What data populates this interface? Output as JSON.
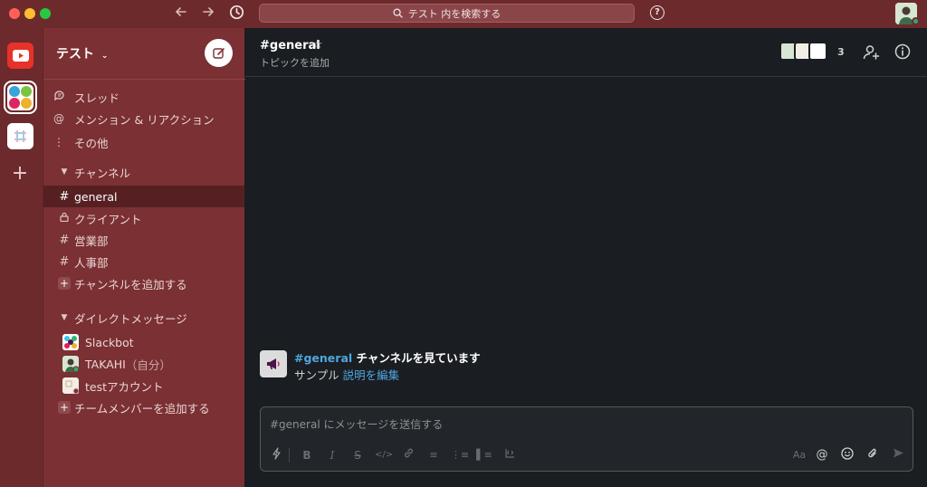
{
  "titlebar": {
    "search_placeholder": "テスト 内を検索する",
    "help_label": "?"
  },
  "rail": {
    "workspaces": [
      "youtube",
      "テスト",
      "slack"
    ]
  },
  "sidebar": {
    "workspace_name": "テスト",
    "top_items": [
      {
        "label": "スレッド",
        "icon": "threads-icon"
      },
      {
        "label": "メンション & リアクション",
        "icon": "at-icon"
      },
      {
        "label": "その他",
        "icon": "more-vertical-icon"
      }
    ],
    "channels_header": "チャンネル",
    "channels": [
      {
        "label": "general",
        "icon": "#",
        "active": true
      },
      {
        "label": "クライアント",
        "icon": "lock",
        "active": false
      },
      {
        "label": "営業部",
        "icon": "#",
        "active": false
      },
      {
        "label": "人事部",
        "icon": "#",
        "active": false
      }
    ],
    "add_channel": "チャンネルを追加する",
    "dm_header": "ダイレクトメッセージ",
    "dms": [
      {
        "label": "Slackbot"
      },
      {
        "label": "TAKAHI",
        "suffix": "（自分）"
      },
      {
        "label": "testアカウント"
      }
    ],
    "add_member": "チームメンバーを追加する"
  },
  "channel": {
    "name": "#general",
    "topic": "トピックを追加",
    "member_count": "3"
  },
  "intro": {
    "channel_link": "#general",
    "title_rest": " チャンネルを見ています",
    "description": "サンプル ",
    "edit_link": "説明を編集"
  },
  "composer": {
    "placeholder": "#general にメッセージを送信する",
    "format_label": "Aa"
  },
  "colors": {
    "sidebar": "#7b3033",
    "titlebar": "#6d2a2c",
    "main_bg": "#1a1d21",
    "link": "#4fa6e0",
    "online": "#2bac76"
  }
}
